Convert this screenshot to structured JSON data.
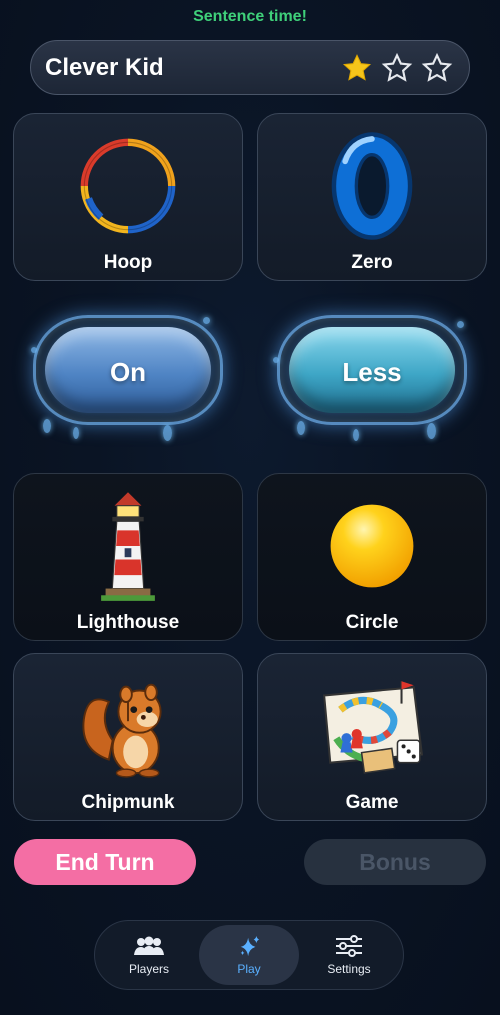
{
  "header": {
    "status": "Sentence time!",
    "player_name": "Clever Kid",
    "stars_filled": 1,
    "stars_total": 3
  },
  "cards": [
    {
      "label": "Hoop",
      "icon": "hoop-icon"
    },
    {
      "label": "Zero",
      "icon": "zero-icon"
    },
    {
      "label": "On",
      "style": "splash-blue"
    },
    {
      "label": "Less",
      "style": "splash-cyan"
    },
    {
      "label": "Lighthouse",
      "icon": "lighthouse-icon"
    },
    {
      "label": "Circle",
      "icon": "circle-icon"
    },
    {
      "label": "Chipmunk",
      "icon": "chipmunk-icon"
    },
    {
      "label": "Game",
      "icon": "board-game-icon"
    }
  ],
  "actions": {
    "end_turn": "End Turn",
    "bonus": "Bonus"
  },
  "tabs": [
    {
      "label": "Players",
      "icon": "players-icon",
      "active": false
    },
    {
      "label": "Play",
      "icon": "sparkle-icon",
      "active": true
    },
    {
      "label": "Settings",
      "icon": "sliders-icon",
      "active": false
    }
  ],
  "colors": {
    "status_green": "#3fd07a",
    "end_turn_pink": "#f46ea4",
    "active_tab_blue": "#5ab0ff",
    "star_gold": "#f6c51b"
  }
}
